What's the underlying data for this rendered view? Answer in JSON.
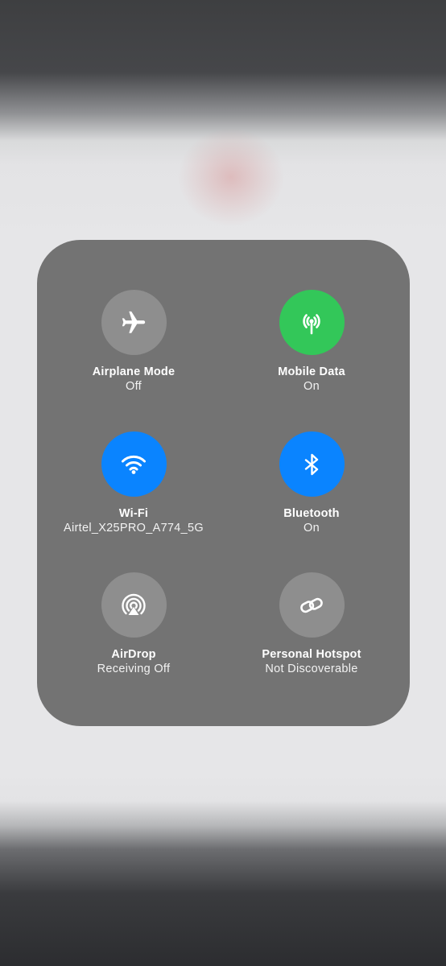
{
  "panel": {
    "toggles": [
      {
        "id": "airplane",
        "label": "Airplane Mode",
        "status": "Off",
        "state": "off",
        "icon": "airplane-icon",
        "color": "#8e8e8e"
      },
      {
        "id": "mobile-data",
        "label": "Mobile Data",
        "status": "On",
        "state": "on",
        "icon": "antenna-icon",
        "color": "#33c759"
      },
      {
        "id": "wifi",
        "label": "Wi-Fi",
        "status": "Airtel_X25PRO_A774_5G",
        "state": "on",
        "icon": "wifi-icon",
        "color": "#0a84ff"
      },
      {
        "id": "bluetooth",
        "label": "Bluetooth",
        "status": "On",
        "state": "on",
        "icon": "bluetooth-icon",
        "color": "#0a84ff"
      },
      {
        "id": "airdrop",
        "label": "AirDrop",
        "status": "Receiving Off",
        "state": "off",
        "icon": "airdrop-icon",
        "color": "#8e8e8e"
      },
      {
        "id": "hotspot",
        "label": "Personal Hotspot",
        "status": "Not Discoverable",
        "state": "off",
        "icon": "hotspot-link-icon",
        "color": "#8e8e8e"
      }
    ]
  }
}
